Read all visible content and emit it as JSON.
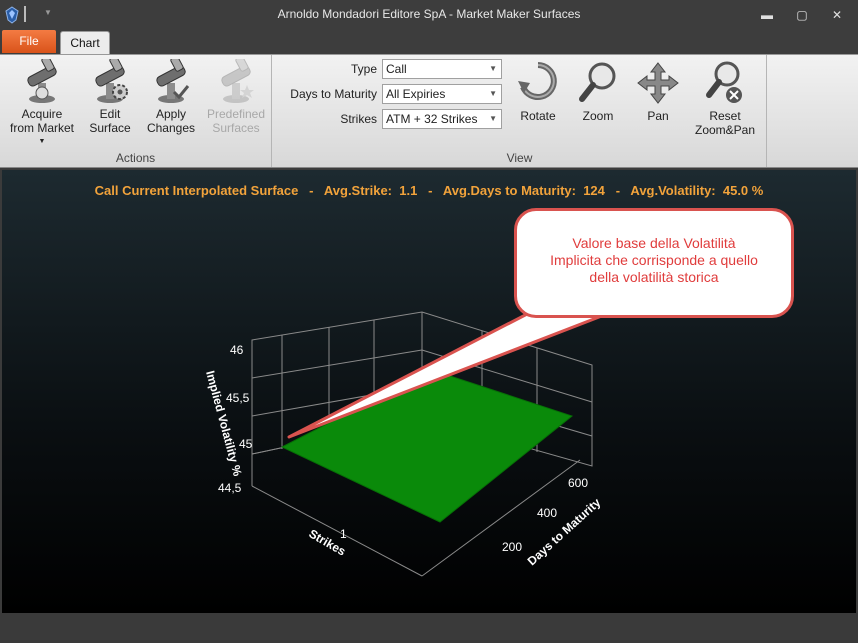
{
  "window": {
    "title": "Arnoldo Mondadori Editore SpA - Market Maker Surfaces",
    "minimize": "▬",
    "maximize": "▢",
    "close": "✕"
  },
  "tabs": {
    "file": "File",
    "chart": "Chart"
  },
  "ribbon": {
    "actions": {
      "label": "Actions",
      "acquire": {
        "line1": "Acquire",
        "line2": "from Market",
        "icon": "telescope-icon"
      },
      "edit": {
        "line1": "Edit",
        "line2": "Surface",
        "icon": "telescope-gear-icon"
      },
      "apply": {
        "line1": "Apply",
        "line2": "Changes",
        "icon": "telescope-check-icon"
      },
      "predefined": {
        "line1": "Predefined",
        "line2": "Surfaces",
        "icon": "telescope-star-icon"
      }
    },
    "view": {
      "label": "View",
      "type_label": "Type",
      "type_value": "Call",
      "days_label": "Days to Maturity",
      "days_value": "All Expiries",
      "strikes_label": "Strikes",
      "strikes_value": "ATM + 32 Strikes",
      "rotate": "Rotate",
      "zoom": "Zoom",
      "pan": "Pan",
      "reset_line1": "Reset",
      "reset_line2": "Zoom&Pan"
    }
  },
  "chart": {
    "title": "Call Current Interpolated Surface   -   Avg.Strike:  1.1   -   Avg.Days to Maturity:  124   -   Avg.Volatility:  45.0 %",
    "callout": {
      "line1": "Valore base della Volatilità",
      "line2": "Implicita che corrisponde a quello",
      "line3": "della volatilità storica"
    },
    "colors": {
      "surface": "#0a8a0a",
      "title": "#f2a33b",
      "callout_border": "#d9534f"
    }
  },
  "chart_data": {
    "type": "surface",
    "zlabel": "Implied Volatility %",
    "xlabel": "Strikes",
    "ylabel": "Days to Maturity",
    "z_ticks": [
      "44,5",
      "45",
      "45,5",
      "46"
    ],
    "x_ticks": [
      "1"
    ],
    "y_ticks": [
      "200",
      "400",
      "600"
    ],
    "zlim": [
      44.5,
      46
    ],
    "surface_value": 45.0
  }
}
